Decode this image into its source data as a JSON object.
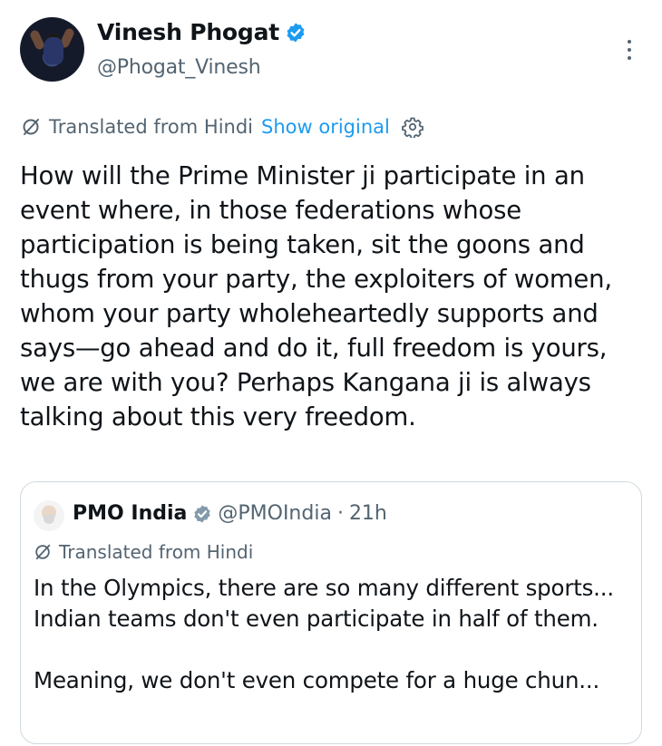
{
  "author": {
    "display_name": "Vinesh Phogat",
    "handle": "@Phogat_Vinesh",
    "verified_color": "#1d9bf0"
  },
  "translation": {
    "label": "Translated from Hindi",
    "show_original": "Show original"
  },
  "tweet": {
    "text": "How will the Prime Minister ji participate in an event where, in those federations whose participation is being taken, sit the goons and thugs from your party, the exploiters of women, whom your party wholeheartedly supports and says—go ahead and do it, full freedom is yours, we are with you? Perhaps Kangana ji is always talking about this very freedom."
  },
  "quote": {
    "display_name": "PMO India",
    "handle": "@PMOIndia",
    "separator": "·",
    "time": "21h",
    "verified_color": "#829aab",
    "translation_label": "Translated from Hindi",
    "paragraph1": "In the Olympics, there are so many different sports... Indian teams don't even participate in half of them.",
    "paragraph2": "Meaning, we don't even compete for a huge chun..."
  },
  "icons": {
    "more": "more-vertical-icon",
    "translate": "translate-slash-icon",
    "settings": "gear-icon",
    "verified": "verified-badge-icon"
  },
  "colors": {
    "text": "#0f1419",
    "secondary": "#536471",
    "link": "#1d9bf0",
    "border": "#cfd9de"
  }
}
